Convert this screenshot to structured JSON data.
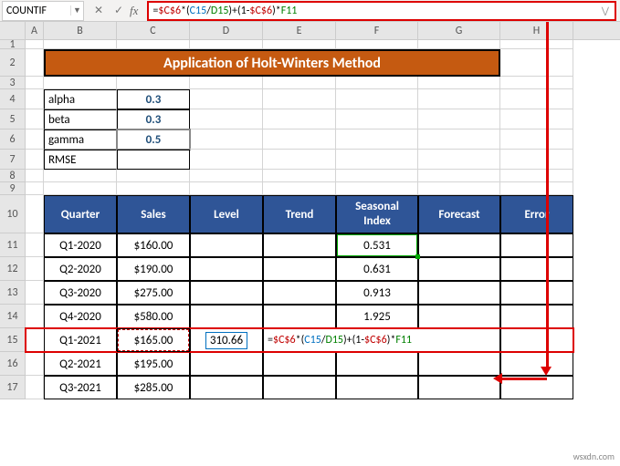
{
  "nameBox": "COUNTIF",
  "formulaBar": {
    "raw": "=$C$6*(C15/D15)+(1-$C$6)*F11"
  },
  "cols": [
    "A",
    "B",
    "C",
    "D",
    "E",
    "F",
    "G",
    "H"
  ],
  "banner": "Application of Holt-Winters Method",
  "params": {
    "alpha": {
      "label": "alpha",
      "value": "0.3"
    },
    "beta": {
      "label": "beta",
      "value": "0.3"
    },
    "gamma": {
      "label": "gamma",
      "value": "0.5"
    },
    "rmse": {
      "label": "RMSE",
      "value": ""
    }
  },
  "headers": {
    "quarter": "Quarter",
    "sales": "Sales",
    "level": "Level",
    "trend": "Trend",
    "seasonal": "Seasonal Index",
    "forecast": "Forecast",
    "error": "Error"
  },
  "rows": [
    {
      "q": "Q1-2020",
      "sales": "$160.00",
      "level": "",
      "trend": "",
      "si": "0.531",
      "fc": "",
      "err": ""
    },
    {
      "q": "Q2-2020",
      "sales": "$190.00",
      "level": "",
      "trend": "",
      "si": "0.631",
      "fc": "",
      "err": ""
    },
    {
      "q": "Q3-2020",
      "sales": "$275.00",
      "level": "",
      "trend": "",
      "si": "0.913",
      "fc": "",
      "err": ""
    },
    {
      "q": "Q4-2020",
      "sales": "$580.00",
      "level": "",
      "trend": "",
      "si": "1.925",
      "fc": "",
      "err": ""
    },
    {
      "q": "Q1-2021",
      "sales": "$165.00",
      "level": "310.66",
      "trend": "=$C$6*(C15/D15)+(1-$C$6)*F11",
      "si": "",
      "fc": "",
      "err": ""
    },
    {
      "q": "Q2-2021",
      "sales": "$195.00",
      "level": "",
      "trend": "",
      "si": "",
      "fc": "",
      "err": ""
    },
    {
      "q": "Q3-2021",
      "sales": "$285.00",
      "level": "",
      "trend": "",
      "si": "",
      "fc": "",
      "err": ""
    }
  ],
  "watermark": "wsxdn.com",
  "chart_data": {
    "type": "table",
    "title": "Application of Holt-Winters Method",
    "parameters": {
      "alpha": 0.3,
      "beta": 0.3,
      "gamma": 0.5
    },
    "columns": [
      "Quarter",
      "Sales",
      "Level",
      "Trend",
      "Seasonal Index",
      "Forecast",
      "Error"
    ],
    "data": [
      {
        "Quarter": "Q1-2020",
        "Sales": 160.0,
        "Seasonal Index": 0.531
      },
      {
        "Quarter": "Q2-2020",
        "Sales": 190.0,
        "Seasonal Index": 0.631
      },
      {
        "Quarter": "Q3-2020",
        "Sales": 275.0,
        "Seasonal Index": 0.913
      },
      {
        "Quarter": "Q4-2020",
        "Sales": 580.0,
        "Seasonal Index": 1.925
      },
      {
        "Quarter": "Q1-2021",
        "Sales": 165.0,
        "Level": 310.66
      },
      {
        "Quarter": "Q2-2021",
        "Sales": 195.0
      },
      {
        "Quarter": "Q3-2021",
        "Sales": 285.0
      }
    ],
    "active_formula": "=$C$6*(C15/D15)+(1-$C$6)*F11"
  }
}
